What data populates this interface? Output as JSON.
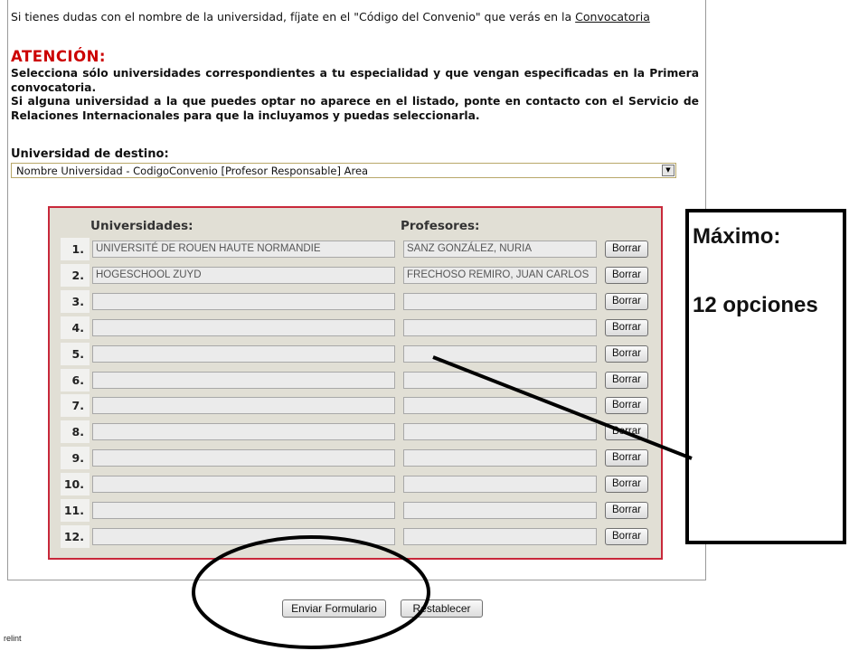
{
  "intro": {
    "text": "Si tienes dudas con el nombre de la universidad, fíjate en el \"Código del Convenio\" que verás en la ",
    "link": "Convocatoria"
  },
  "attention": {
    "title": "ATENCIÓN:",
    "line1": "Selecciona sólo universidades correspondientes a tu especialidad y que vengan especificadas en la Primera convocatoria.",
    "line2": "Si alguna universidad a la que puedes optar no aparece en el listado, ponte en contacto con el Servicio de Relaciones Internacionales para que la incluyamos y puedas seleccionarla."
  },
  "destino": {
    "label": "Universidad de destino:",
    "selected": "Nombre Universidad - CodigoConvenio [Profesor Responsable] Area"
  },
  "table": {
    "col_universidades": "Universidades:",
    "col_profesores": "Profesores:",
    "delete_label": "Borrar",
    "rows": [
      {
        "num": "1.",
        "university": "UNIVERSITÉ DE ROUEN HAUTE NORMANDIE",
        "professor": "SANZ GONZÁLEZ, NURIA"
      },
      {
        "num": "2.",
        "university": "HOGESCHOOL ZUYD",
        "professor": "FRECHOSO REMIRO, JUAN CARLOS"
      },
      {
        "num": "3.",
        "university": "",
        "professor": ""
      },
      {
        "num": "4.",
        "university": "",
        "professor": ""
      },
      {
        "num": "5.",
        "university": "",
        "professor": ""
      },
      {
        "num": "6.",
        "university": "",
        "professor": ""
      },
      {
        "num": "7.",
        "university": "",
        "professor": ""
      },
      {
        "num": "8.",
        "university": "",
        "professor": ""
      },
      {
        "num": "9.",
        "university": "",
        "professor": ""
      },
      {
        "num": "10.",
        "university": "",
        "professor": ""
      },
      {
        "num": "11.",
        "university": "",
        "professor": ""
      },
      {
        "num": "12.",
        "university": "",
        "professor": ""
      }
    ]
  },
  "buttons": {
    "submit": "Enviar Formulario",
    "reset": "Restablecer"
  },
  "footer": "relint",
  "annotation": {
    "line1": "Máximo:",
    "line2": "12 opciones"
  },
  "colors": {
    "attention_red": "#cc0000",
    "table_border": "#c8283a",
    "table_bg": "#e1dfd5"
  }
}
